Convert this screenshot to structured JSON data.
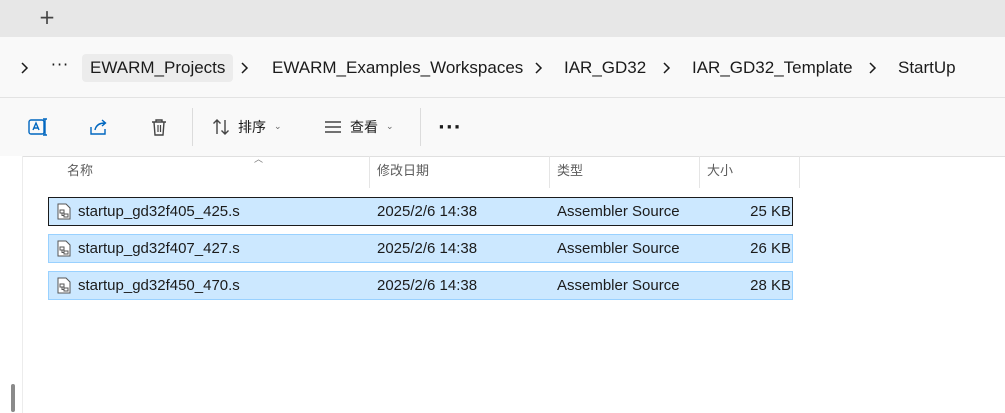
{
  "tabbar": {
    "new_tab_symbol": "+"
  },
  "breadcrumb": {
    "overflow": "···",
    "items": [
      "EWARM_Projects",
      "EWARM_Examples_Workspaces",
      "IAR_GD32",
      "IAR_GD32_Template",
      "StartUp"
    ]
  },
  "toolbar": {
    "sort_label": "排序",
    "view_label": "查看",
    "more_label": "···"
  },
  "columns": {
    "name": "名称",
    "modified": "修改日期",
    "type": "类型",
    "size": "大小"
  },
  "files": [
    {
      "name": "startup_gd32f405_425.s",
      "modified": "2025/2/6 14:38",
      "type": "Assembler Source",
      "size": "25 KB"
    },
    {
      "name": "startup_gd32f407_427.s",
      "modified": "2025/2/6 14:38",
      "type": "Assembler Source",
      "size": "26 KB"
    },
    {
      "name": "startup_gd32f450_470.s",
      "modified": "2025/2/6 14:38",
      "type": "Assembler Source",
      "size": "28 KB"
    }
  ],
  "colors": {
    "selection_bg": "#cce8ff",
    "selection_border": "#99d1ff",
    "accent": "#0067c0"
  }
}
